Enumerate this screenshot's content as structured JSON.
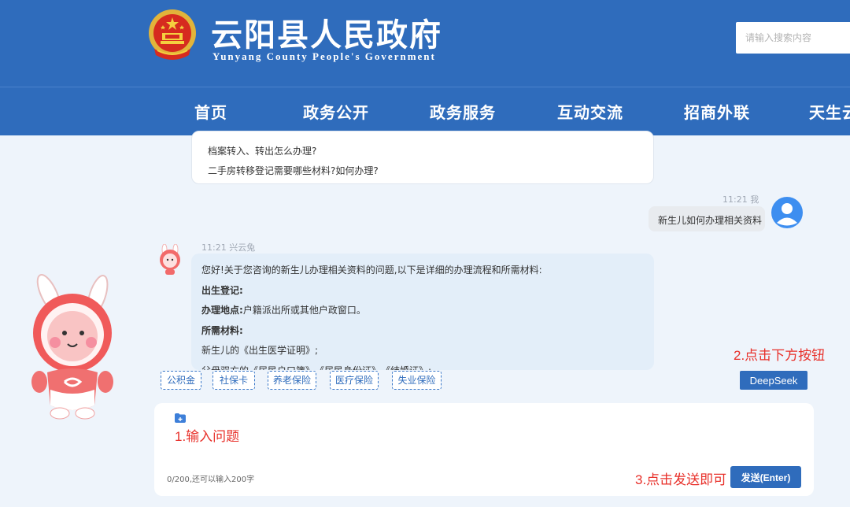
{
  "header": {
    "title": "云阳县人民政府",
    "subtitle": "Yunyang County People's Government",
    "search_placeholder": "请输入搜索内容"
  },
  "nav": {
    "items": [
      "首页",
      "政务公开",
      "政务服务",
      "互动交流",
      "招商外联",
      "天生云"
    ]
  },
  "chat": {
    "suggestions": [
      "档案转入、转出怎么办理?",
      "二手房转移登记需要哪些材料?如何办理?"
    ],
    "user_message": {
      "time": "11:21",
      "sender": "我",
      "text": "新生儿如何办理相关资料"
    },
    "bot_message": {
      "time": "11:21",
      "sender": "兴云兔",
      "lines": [
        "您好!关于您咨询的新生儿办理相关资料的问题,以下是详细的办理流程和所需材料:",
        "出生登记:",
        "办理地点:",
        "户籍派出所或其他户政窗口。",
        "所需材料:",
        "新生儿的《出生医学证明》;",
        "父母双方的《居民户口簿》、《居民身份证》、《结婚证》;"
      ]
    }
  },
  "tags": [
    "公积金",
    "社保卡",
    "养老保险",
    "医疗保险",
    "失业保险"
  ],
  "hints": {
    "step1": "1.输入问题",
    "step2": "2.点击下方按钮",
    "step3": "3.点击发送即可"
  },
  "deepseek_label": "DeepSeek",
  "input": {
    "char_count": "0/200,还可以输入200字",
    "send_label": "发送(Enter)"
  },
  "colors": {
    "brand_blue": "#2f6cbc",
    "hint_red": "#e8302a",
    "bot_bubble": "#e3eef9",
    "user_bubble": "#e8ebef"
  }
}
